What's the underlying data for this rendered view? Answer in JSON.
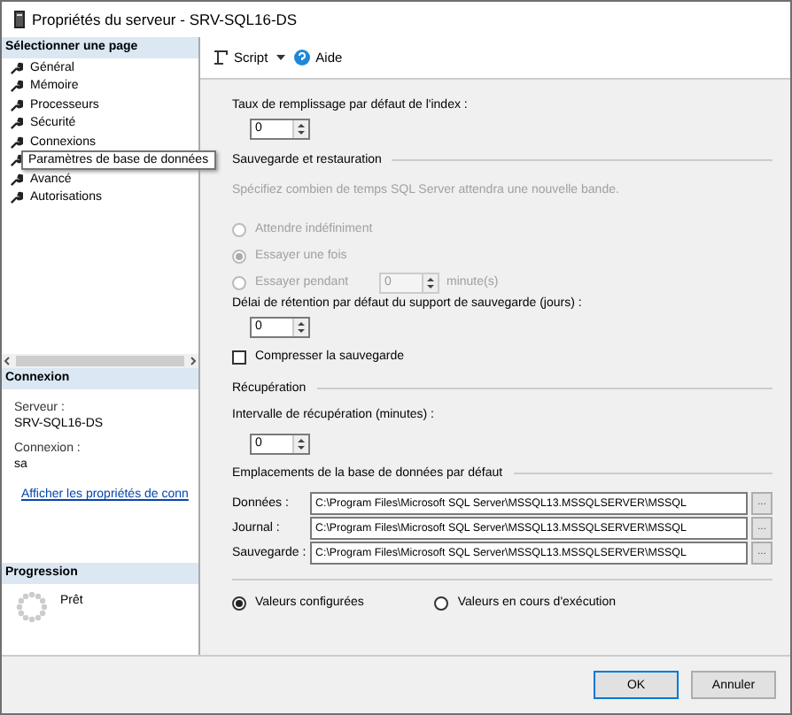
{
  "window": {
    "title": "Propriétés du serveur - SRV-SQL16-DS"
  },
  "sidebar": {
    "header": "Sélectionner une page",
    "pages": [
      {
        "label": "Général",
        "kind": "item"
      },
      {
        "label": "Mémoire",
        "kind": "item"
      },
      {
        "label": "Processeurs",
        "kind": "item"
      },
      {
        "label": "Sécurité",
        "kind": "item"
      },
      {
        "label": "Connexions",
        "kind": "item"
      },
      {
        "label": "Paramètres de base de données",
        "kind": "tooltip"
      },
      {
        "label": "Avancé",
        "kind": "item"
      },
      {
        "label": "Autorisations",
        "kind": "item"
      }
    ],
    "connection": {
      "header": "Connexion",
      "server_label": "Serveur :",
      "server": "SRV-SQL16-DS",
      "login_label": "Connexion :",
      "login": "sa",
      "link": "Afficher les propriétés de conn"
    },
    "progress": {
      "header": "Progression",
      "status": "Prêt"
    }
  },
  "toolbar": {
    "script": "Script",
    "help": "Aide"
  },
  "content": {
    "index_fill": {
      "label": "Taux de remplissage par défaut de l'index :",
      "value": "0"
    },
    "backup": {
      "title": "Sauvegarde et restauration",
      "hint": "Spécifiez combien de temps SQL Server attendra une nouvelle bande.",
      "options": [
        {
          "label": "Attendre indéfiniment",
          "selected": false,
          "disabled": true
        },
        {
          "label": "Essayer une fois",
          "selected": true,
          "disabled": true
        },
        {
          "label": "Essayer pendant",
          "selected": false,
          "disabled": true
        }
      ],
      "retry_value": "0",
      "retry_unit": "minute(s)",
      "retention_label": "Délai de rétention par défaut du support de sauvegarde (jours) :",
      "retention_value": "0",
      "compress": {
        "label": "Compresser la sauvegarde",
        "checked": false
      }
    },
    "recovery": {
      "title": "Récupération",
      "interval_label": "Intervalle de récupération (minutes) :",
      "interval_value": "0"
    },
    "locations": {
      "title": "Emplacements de la base de données par défaut",
      "fields": [
        {
          "label": "Données :",
          "value": "C:\\Program Files\\Microsoft SQL Server\\MSSQL13.MSSQLSERVER\\MSSQL",
          "browse": "..."
        },
        {
          "label": "Journal :",
          "value": "C:\\Program Files\\Microsoft SQL Server\\MSSQL13.MSSQLSERVER\\MSSQL",
          "browse": "..."
        },
        {
          "label": "Sauvegarde :",
          "value": "C:\\Program Files\\Microsoft SQL Server\\MSSQL13.MSSQLSERVER\\MSSQL",
          "browse": "..."
        }
      ]
    },
    "view": [
      {
        "label": "Valeurs configurées",
        "selected": true
      },
      {
        "label": "Valeurs en cours d'exécution",
        "selected": false
      }
    ]
  },
  "buttons": [
    "OK",
    "Annuler"
  ]
}
